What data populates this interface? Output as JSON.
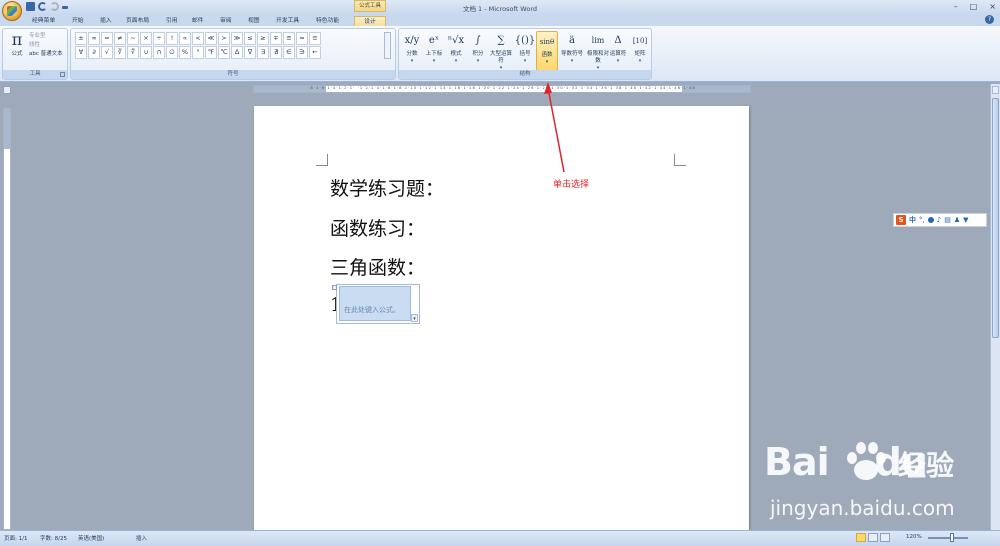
{
  "window": {
    "title": "文档 1 - Microsoft Word",
    "contextual_header": "公式工具",
    "controls": [
      "–",
      "□",
      "×"
    ]
  },
  "tabs": [
    {
      "label": "经典菜单"
    },
    {
      "label": "开始"
    },
    {
      "label": "插入"
    },
    {
      "label": "页面布局"
    },
    {
      "label": "引用"
    },
    {
      "label": "邮件"
    },
    {
      "label": "审阅"
    },
    {
      "label": "视图"
    },
    {
      "label": "开发工具"
    },
    {
      "label": "特色功能"
    },
    {
      "label": "设计"
    }
  ],
  "ribbon": {
    "tools": {
      "label": "工具",
      "formula": "公式",
      "pi": "π",
      "items": [
        "专业型",
        "线性",
        "abc 普通文本"
      ]
    },
    "symbols": {
      "label": "符号",
      "row1": [
        "±",
        "∞",
        "=",
        "≠",
        "~",
        "×",
        "÷",
        "!",
        "∝",
        "<",
        "≪",
        ">",
        "≫",
        "≤",
        "≥",
        "∓",
        "≅",
        "≈",
        "≡"
      ],
      "row2": [
        "∀",
        "∂",
        "√",
        "∛",
        "∜",
        "∪",
        "∩",
        "∅",
        "%",
        "°",
        "℉",
        "℃",
        "∆",
        "∇",
        "∃",
        "∄",
        "∈",
        "∋",
        "←"
      ]
    },
    "structures": {
      "label": "结构",
      "items": [
        {
          "icon": "x/y",
          "label": "分数"
        },
        {
          "icon": "eˣ",
          "label": "上下标"
        },
        {
          "icon": "ⁿ√x",
          "label": "根式"
        },
        {
          "icon": "∫",
          "label": "积分"
        },
        {
          "icon": "∑",
          "label": "大型运算符"
        },
        {
          "icon": "{()}",
          "label": "括号"
        },
        {
          "icon": "sinθ",
          "label": "函数"
        },
        {
          "icon": "ä",
          "label": "导数符号"
        },
        {
          "icon": "lim",
          "label": "极限和对数"
        },
        {
          "icon": "Δ",
          "label": "运算符"
        },
        {
          "icon": "[10]",
          "label": "矩阵"
        }
      ]
    }
  },
  "ruler": {
    "numbers": "·8·1·6·1·4·1·2·1· ·1·2·1·4·1·6·1·8·1·10·1·12·1·14·1·16·1·18·1·20·1·22·1·24·1·26·1·28·1·30·1·32·1·34·1·36·1·38·1·40·1·42·1·44·1·46·1·48"
  },
  "document": {
    "line1": "数学练习题：",
    "line2": "函数练习：",
    "line3": "三角函数：",
    "line4_prefix": "1",
    "equation_placeholder": "在此处键入公式。"
  },
  "annotation": {
    "text": "单击选择",
    "color": "#e0252a"
  },
  "ime_toolbar": {
    "logo": "S",
    "mode": "中"
  },
  "status": {
    "page": "页面: 1/1",
    "words": "字数: 8/25",
    "language": "英语(美国)",
    "insert": "插入",
    "zoom": "120%"
  },
  "watermark": {
    "brand": "Bai",
    "brand2": "du",
    "cn": "经验",
    "url": "jingyan.baidu.com"
  }
}
